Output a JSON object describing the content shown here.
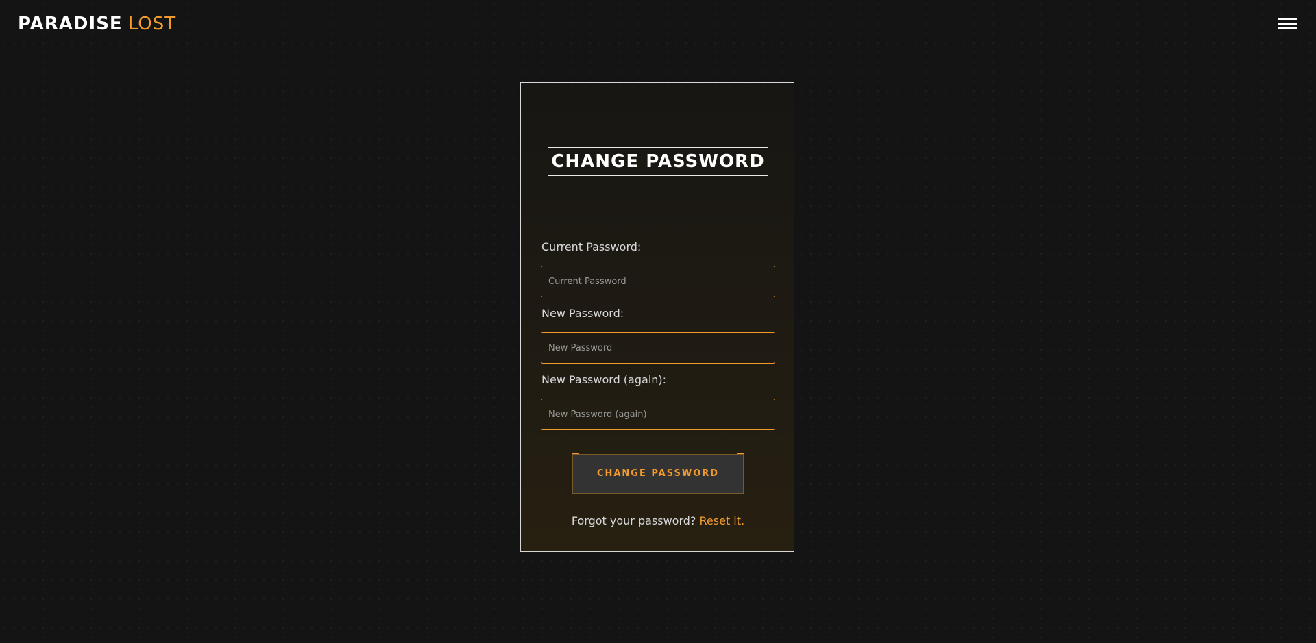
{
  "header": {
    "logo_primary": "PARADISE",
    "logo_accent": "LOST",
    "menu_icon": "hamburger-menu-icon"
  },
  "form": {
    "title": "CHANGE PASSWORD",
    "fields": [
      {
        "label": "Current Password:",
        "placeholder": "Current Password",
        "value": ""
      },
      {
        "label": "New Password:",
        "placeholder": "New Password",
        "value": ""
      },
      {
        "label": "New Password (again):",
        "placeholder": "New Password (again)",
        "value": ""
      }
    ],
    "submit_label": "CHANGE PASSWORD",
    "forgot_text": "Forgot your password?",
    "reset_link": "Reset it."
  },
  "colors": {
    "accent": "#f39a2e",
    "background": "#141414",
    "text": "#e6e6e6"
  }
}
